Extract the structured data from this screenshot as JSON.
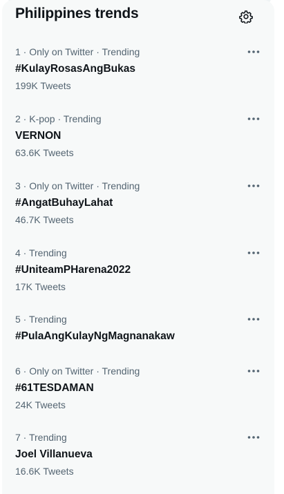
{
  "header": {
    "title": "Philippines trends",
    "settings_icon": "gear-icon"
  },
  "trends": [
    {
      "meta": "1 · Only on Twitter · Trending",
      "name": "#KulayRosasAngBukas",
      "count": "199K Tweets"
    },
    {
      "meta": "2 · K-pop · Trending",
      "name": "VERNON",
      "count": "63.6K Tweets"
    },
    {
      "meta": "3 · Only on Twitter · Trending",
      "name": "#AngatBuhayLahat",
      "count": "46.7K Tweets"
    },
    {
      "meta": "4 · Trending",
      "name": "#UniteamPHarena2022",
      "count": "17K Tweets"
    },
    {
      "meta": "5 · Trending",
      "name": "#PulaAngKulayNgMagnanakaw",
      "count": ""
    },
    {
      "meta": "6 · Only on Twitter · Trending",
      "name": "#61TESDAMAN",
      "count": "24K Tweets"
    },
    {
      "meta": "7 · Trending",
      "name": "Joel Villanueva",
      "count": "16.6K Tweets"
    }
  ],
  "colors": {
    "panel_bg": "#f7f9f9",
    "primary_text": "#0f1419",
    "secondary_text": "#536471"
  }
}
